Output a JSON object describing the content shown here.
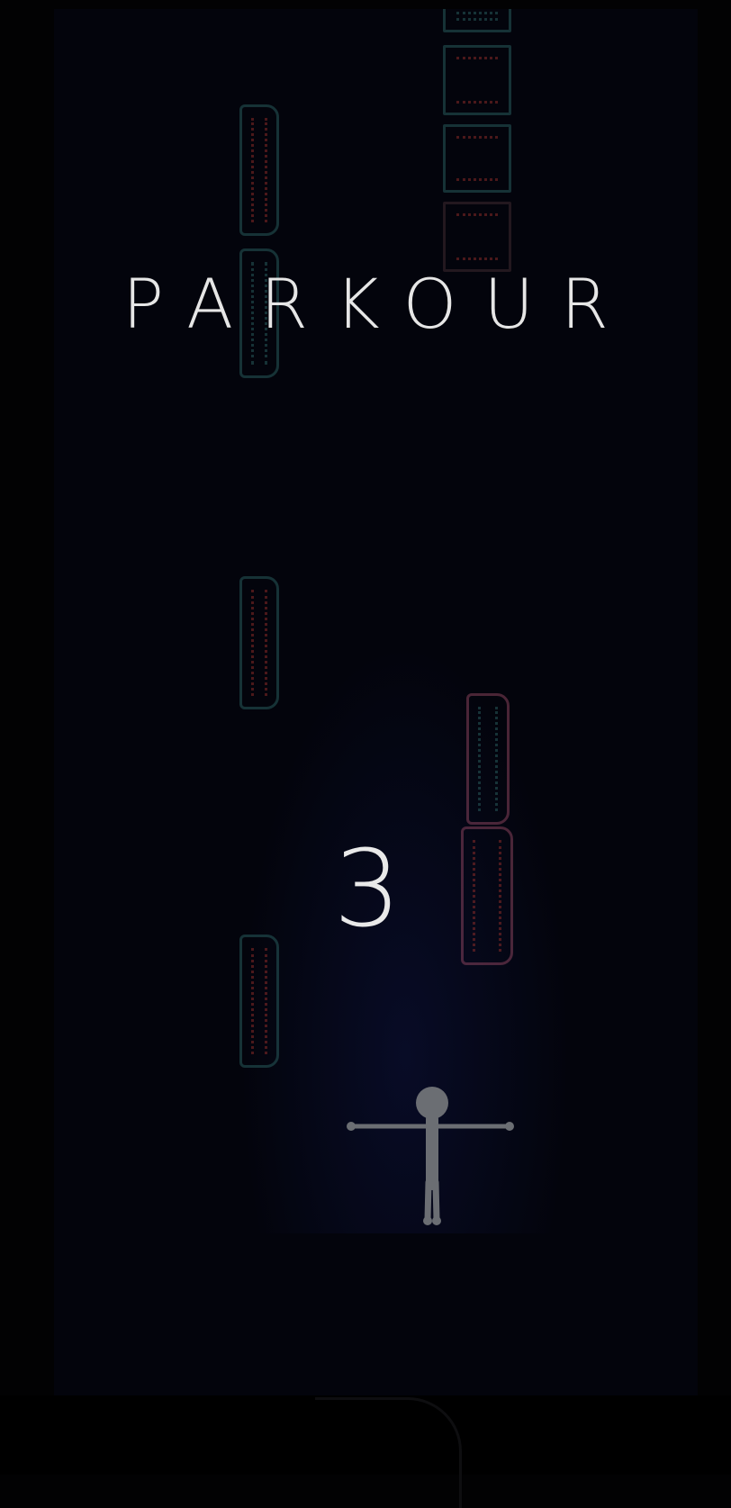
{
  "game": {
    "title": "PARKOUR",
    "countdown": "3"
  },
  "colors": {
    "background": "#03040c",
    "text": "#e6e6e6",
    "sign_teal": "#2e6b6a",
    "sign_red": "#a3322c",
    "sign_pink": "#a04d69",
    "runner": "#6b6e73"
  },
  "icons": {
    "runner": "stick-figure-icon",
    "signs": "neon-sign-icon"
  }
}
